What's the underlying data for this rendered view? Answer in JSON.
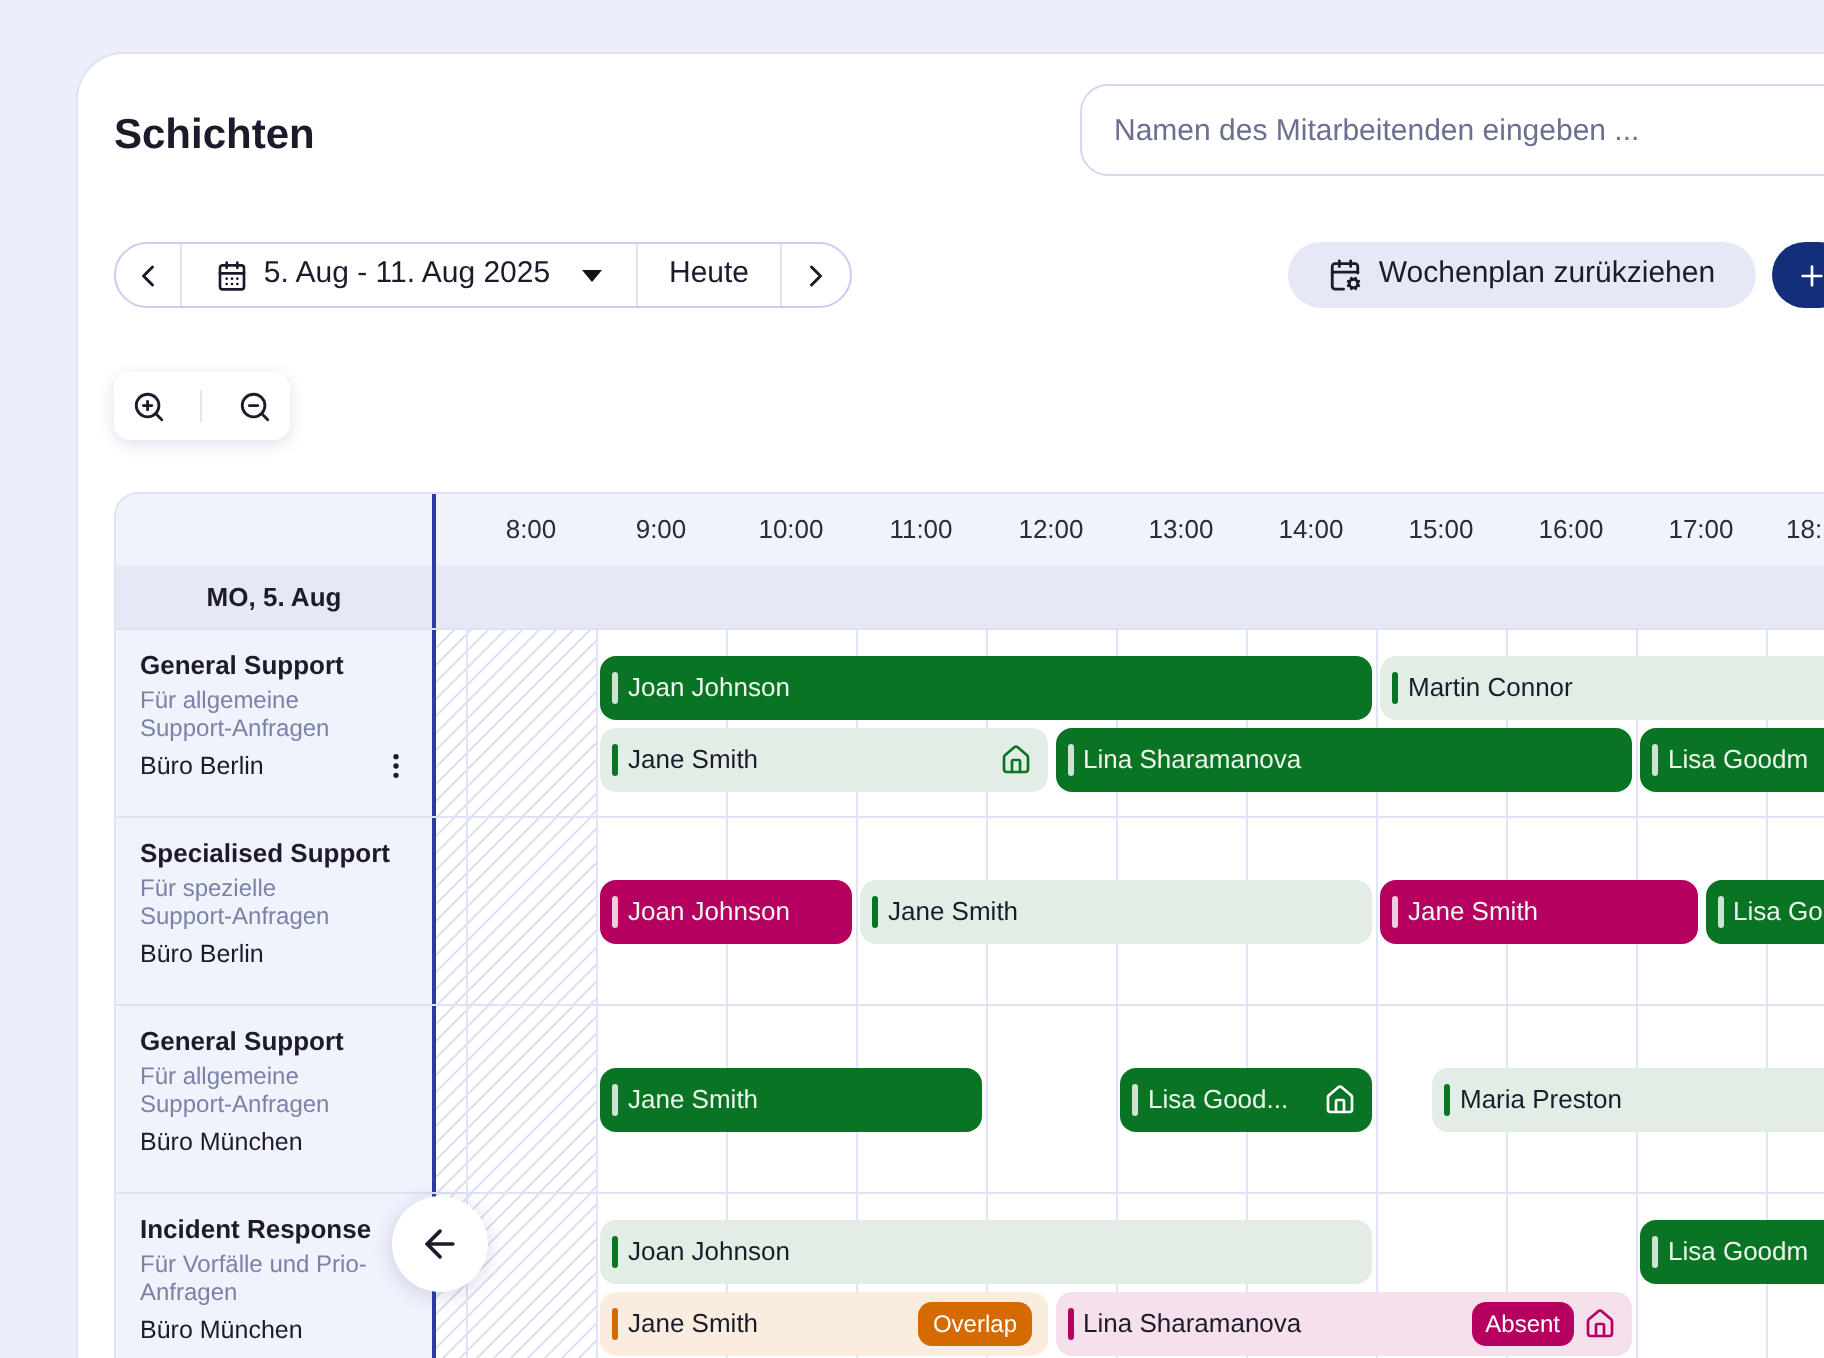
{
  "title": "Schichten",
  "search": {
    "placeholder": "Namen des Mitarbeitenden eingeben ..."
  },
  "date_range": "5. Aug - 11. Aug 2025",
  "today_button": "Heute",
  "retract_button": "Wochenplan zurükziehen",
  "hours": [
    "8:00",
    "9:00",
    "10:00",
    "11:00",
    "12:00",
    "13:00",
    "14:00",
    "15:00",
    "16:00",
    "17:00",
    "18:"
  ],
  "day_label": "MO, 5. Aug",
  "groups": [
    {
      "title": "General Support",
      "subtitle": "Für allgemeine Support-Anfragen",
      "location": "Büro Berlin",
      "menu": true,
      "lanes": [
        {
          "shifts": [
            {
              "name": "Joan Johnson",
              "kind": "solid",
              "color": "#0a7425",
              "home": false
            },
            {
              "name": "Martin Connor",
              "kind": "light",
              "color": "#0a7425",
              "home": false
            }
          ]
        },
        {
          "shifts": [
            {
              "name": "Jane Smith",
              "kind": "light",
              "color": "#0a7425",
              "home": true
            },
            {
              "name": "Lina Sharamanova",
              "kind": "solid",
              "color": "#0a7425",
              "home": false
            },
            {
              "name": "Lisa Goodm",
              "kind": "solid",
              "color": "#0a7425",
              "home": false
            }
          ]
        }
      ]
    },
    {
      "title": "Specialised Support",
      "subtitle": "Für spezielle Support-Anfragen",
      "location": "Büro Berlin",
      "menu": false,
      "lanes": [
        {
          "shifts": [
            {
              "name": "Joan Johnson",
              "kind": "solid",
              "color": "#b5005f",
              "home": false
            },
            {
              "name": "Jane Smith",
              "kind": "light",
              "color": "#0a7425",
              "home": false
            },
            {
              "name": "Jane Smith",
              "kind": "solid",
              "color": "#b5005f",
              "home": false
            },
            {
              "name": "Lisa Go",
              "kind": "solid",
              "color": "#0a7425",
              "home": false
            }
          ]
        }
      ]
    },
    {
      "title": "General Support",
      "subtitle": "Für allgemeine Support-Anfragen",
      "location": "Büro München",
      "menu": false,
      "lanes": [
        {
          "shifts": [
            {
              "name": "Jane Smith",
              "kind": "solid",
              "color": "#0a7425",
              "home": false
            },
            {
              "name": "Lisa Good...",
              "kind": "solid",
              "color": "#0a7425",
              "home": true
            },
            {
              "name": "Maria Preston",
              "kind": "light",
              "color": "#0a7425",
              "home": false
            }
          ]
        }
      ]
    },
    {
      "title": "Incident Response",
      "subtitle": "Für Vorfälle und Prio-Anfragen",
      "location": "Büro München",
      "menu": false,
      "lanes": [
        {
          "shifts": [
            {
              "name": "Joan Johnson",
              "kind": "light",
              "color": "#0a7425",
              "home": false
            },
            {
              "name": "Lisa Goodm",
              "kind": "solid",
              "color": "#0a7425",
              "home": false
            }
          ]
        },
        {
          "shifts": [
            {
              "name": "Jane Smith",
              "kind": "light",
              "color": "#d46a00",
              "home": false,
              "badge": "Overlap"
            },
            {
              "name": "Lina Sharamanova",
              "kind": "light",
              "color": "#b5005f",
              "home": true,
              "badge": "Absent"
            }
          ]
        }
      ]
    }
  ]
}
